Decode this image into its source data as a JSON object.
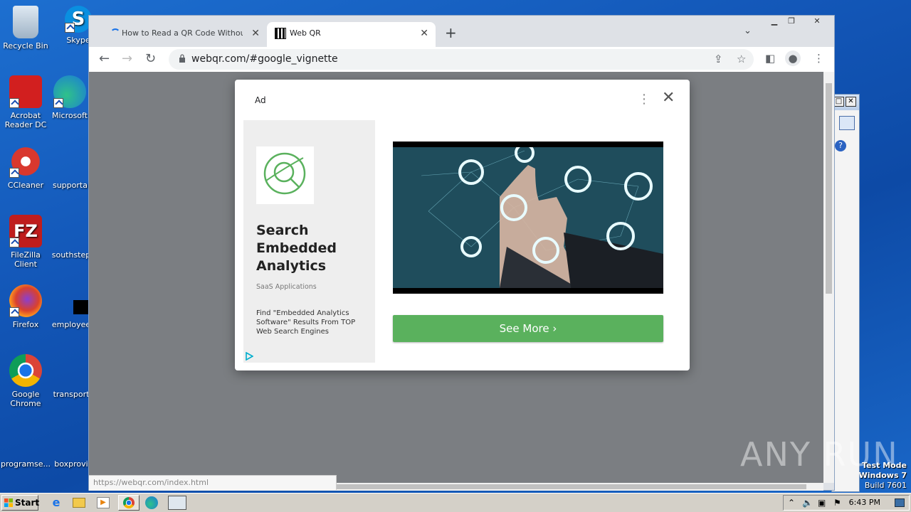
{
  "desktop": {
    "icons": [
      {
        "label": "Recycle Bin"
      },
      {
        "label": "Skype"
      },
      {
        "label": "Acrobat Reader DC"
      },
      {
        "label": "Microsoft"
      },
      {
        "label": "CCleaner"
      },
      {
        "label": "supportal"
      },
      {
        "label": "FileZilla Client"
      },
      {
        "label": "southstep"
      },
      {
        "label": "Firefox"
      },
      {
        "label": "employee"
      },
      {
        "label": "Google Chrome"
      },
      {
        "label": "transport"
      },
      {
        "label": "programse..."
      },
      {
        "label": "boxprovi"
      }
    ]
  },
  "browser": {
    "tabs": [
      {
        "title": "How to Read a QR Code Without a C"
      },
      {
        "title": "Web QR"
      }
    ],
    "new_tab": "+",
    "url": "webqr.com/#google_vignette",
    "status_url": "https://webqr.com/index.html"
  },
  "ad": {
    "label": "Ad",
    "headline_lines": [
      "Search",
      "Embedded",
      "Analytics"
    ],
    "subtitle": "SaaS Applications",
    "description": "Find \"Embedded Analytics Software\" Results From TOP Web Search Engines",
    "cta": "See More"
  },
  "watermark": {
    "brand": "ANY RUN",
    "test_mode": "Test Mode",
    "os": "Windows 7",
    "build": "Build 7601"
  },
  "taskbar": {
    "start": "Start",
    "clock": "6:43 PM"
  },
  "colors": {
    "cta_green": "#5ab15d",
    "desktop_blue": "#1357b8"
  }
}
